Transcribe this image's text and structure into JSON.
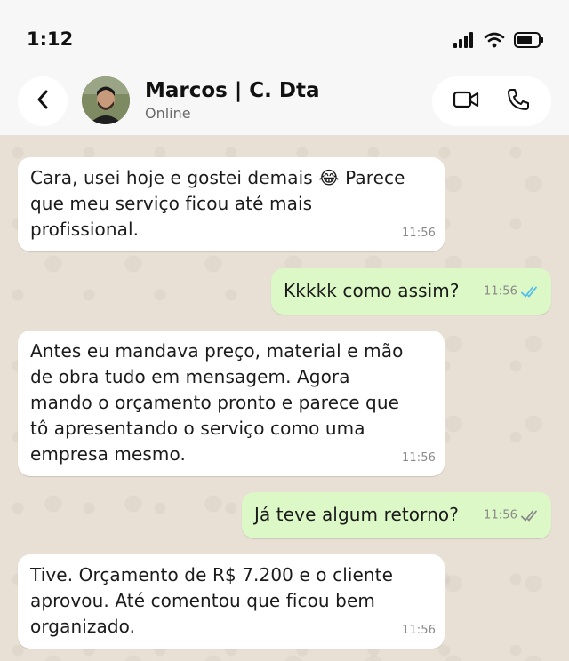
{
  "status_bar": {
    "time": "1:12"
  },
  "header": {
    "contact_name": "Marcos | C. Dta",
    "contact_status": "Online"
  },
  "messages": [
    {
      "direction": "in",
      "text": "Cara, usei hoje e gostei demais 😂 Parece\nque meu serviço ficou até mais\nprofissional.",
      "time": "11:56"
    },
    {
      "direction": "out",
      "text": "Kkkkk como assim?",
      "time": "11:56",
      "status": "read"
    },
    {
      "direction": "in",
      "text": "Antes eu mandava preço, material e mão\nde obra tudo em mensagem. Agora\nmando o orçamento pronto e parece que\ntô apresentando o serviço como uma\nempresa mesmo.",
      "time": "11:56"
    },
    {
      "direction": "out",
      "text": "Já teve algum retorno?",
      "time": "11:56",
      "status": "delivered"
    },
    {
      "direction": "in",
      "text": "Tive. Orçamento de R$ 7.200 e o cliente\naprovou. Até comentou que ficou bem\norganizado.",
      "time": "11:56"
    }
  ],
  "colors": {
    "read_ticks": "#53bdeb",
    "delivered_ticks": "#8a8a8a",
    "outgoing_bubble": "#dcf8c6"
  }
}
